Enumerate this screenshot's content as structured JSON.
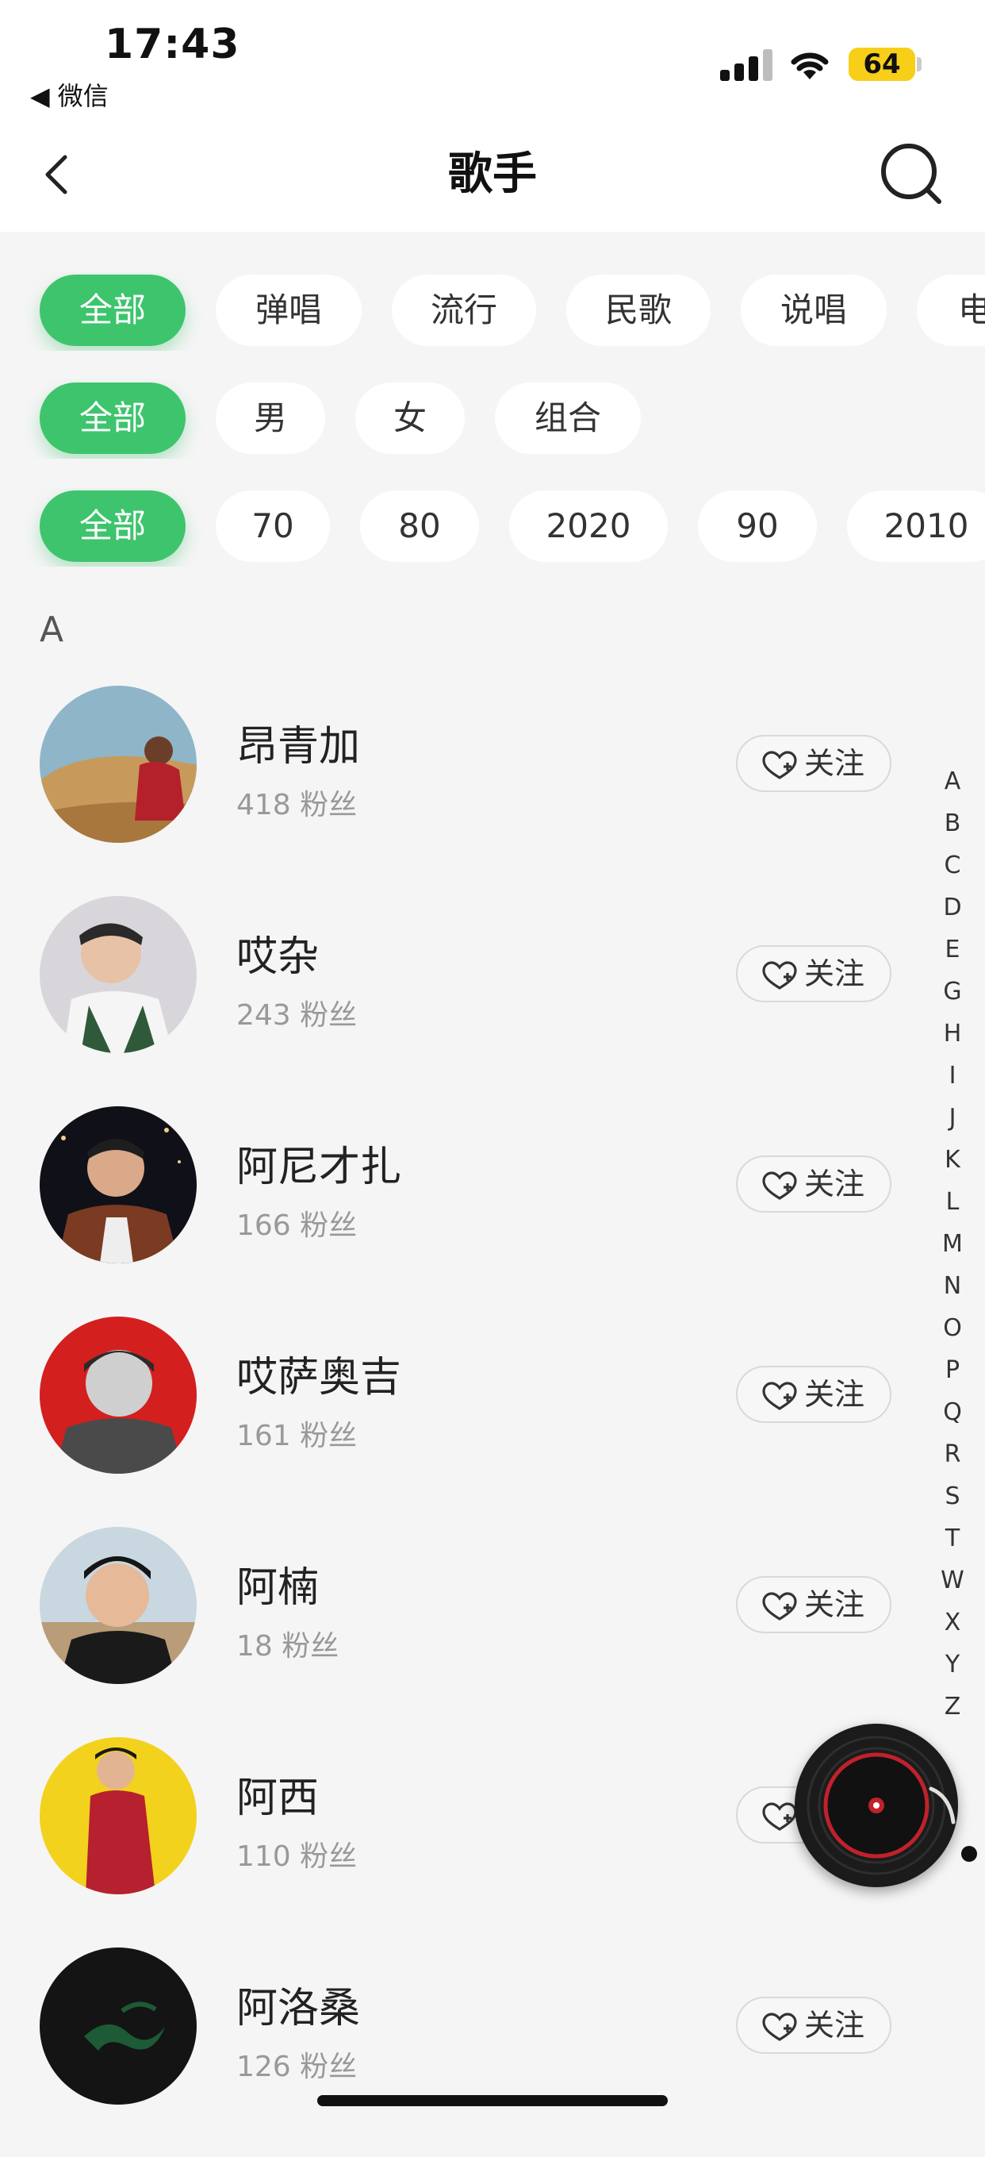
{
  "status_bar": {
    "time": "17:43",
    "back_app": "◀ 微信",
    "battery": "64"
  },
  "nav": {
    "title": "歌手"
  },
  "filters": {
    "genre": [
      "全部",
      "弹唱",
      "流行",
      "民歌",
      "说唱",
      "电"
    ],
    "gender": [
      "全部",
      "男",
      "女",
      "组合"
    ],
    "era": [
      "全部",
      "70",
      "80",
      "2020",
      "90",
      "2010"
    ]
  },
  "section": {
    "letter": "A"
  },
  "follow_label": "关注",
  "artists": [
    {
      "name": "昂青加",
      "fans": "418 粉丝"
    },
    {
      "name": "哎杂",
      "fans": "243 粉丝"
    },
    {
      "name": "阿尼才扎",
      "fans": "166 粉丝"
    },
    {
      "name": "哎萨奥吉",
      "fans": "161 粉丝"
    },
    {
      "name": "阿楠",
      "fans": "18 粉丝"
    },
    {
      "name": "阿西",
      "fans": "110 粉丝"
    },
    {
      "name": "阿洛桑",
      "fans": "126 粉丝"
    }
  ],
  "index": [
    "A",
    "B",
    "C",
    "D",
    "E",
    "G",
    "H",
    "I",
    "J",
    "K",
    "L",
    "M",
    "N",
    "O",
    "P",
    "Q",
    "R",
    "S",
    "T",
    "W",
    "X",
    "Y",
    "Z"
  ],
  "colors": {
    "accent": "#3ec46d",
    "battery": "#f7cf19"
  }
}
